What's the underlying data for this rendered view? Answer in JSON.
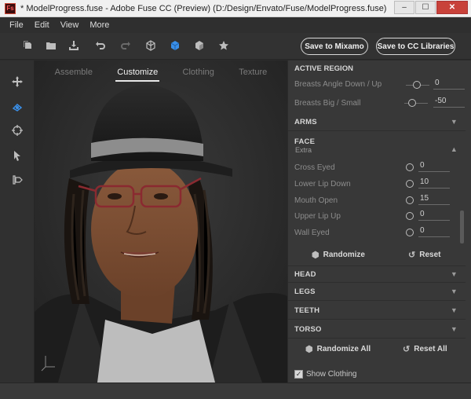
{
  "window": {
    "app_icon": "Fs",
    "title": "* ModelProgress.fuse - Adobe Fuse CC (Preview) (D:/Design/Envato/Fuse/ModelProgress.fuse)",
    "minimize": "–",
    "maximize": "☐",
    "close": "✕"
  },
  "menu": [
    "File",
    "Edit",
    "View",
    "More"
  ],
  "toolbar": {
    "save_mixamo": "Save to Mixamo",
    "save_cc": "Save to CC Libraries",
    "icons": [
      "new-file-icon",
      "open-folder-icon",
      "import-icon",
      "undo-icon",
      "redo-icon",
      "wireframe-cube-icon",
      "solid-cube-icon",
      "shaded-cube-icon",
      "star-icon"
    ]
  },
  "sidebar": {
    "icons": [
      "move-icon",
      "customize-body-icon",
      "target-icon",
      "cursor-icon",
      "export-icon"
    ],
    "active_index": 1
  },
  "viewport": {
    "tabs": [
      "Assemble",
      "Customize",
      "Clothing",
      "Texture"
    ],
    "active_tab": "Customize",
    "gizmo": "y\nz  x"
  },
  "panel": {
    "active_region": {
      "title": "ACTIVE REGION",
      "rows": [
        {
          "label": "Breasts Angle Down / Up",
          "value": "0"
        },
        {
          "label": "Breasts Big / Small",
          "value": "-50"
        }
      ]
    },
    "arms": "ARMS",
    "face": {
      "title": "FACE",
      "sub": "Extra",
      "rows": [
        {
          "label": "Cross Eyed",
          "value": "0"
        },
        {
          "label": "Lower Lip Down",
          "value": "10"
        },
        {
          "label": "Mouth Open",
          "value": "15"
        },
        {
          "label": "Upper Lip Up",
          "value": "0"
        },
        {
          "label": "Wall Eyed",
          "value": "0"
        }
      ],
      "randomize": "Randomize",
      "reset": "Reset"
    },
    "sections": [
      "HEAD",
      "LEGS",
      "TEETH",
      "TORSO"
    ],
    "randomize_all": "Randomize All",
    "reset_all": "Reset All",
    "show_clothing": "Show Clothing",
    "show_clothing_checked": true
  },
  "colors": {
    "accent": "#3a8fe8",
    "panel_bg": "#383838",
    "viewport_bg": "#2a2a2a"
  }
}
